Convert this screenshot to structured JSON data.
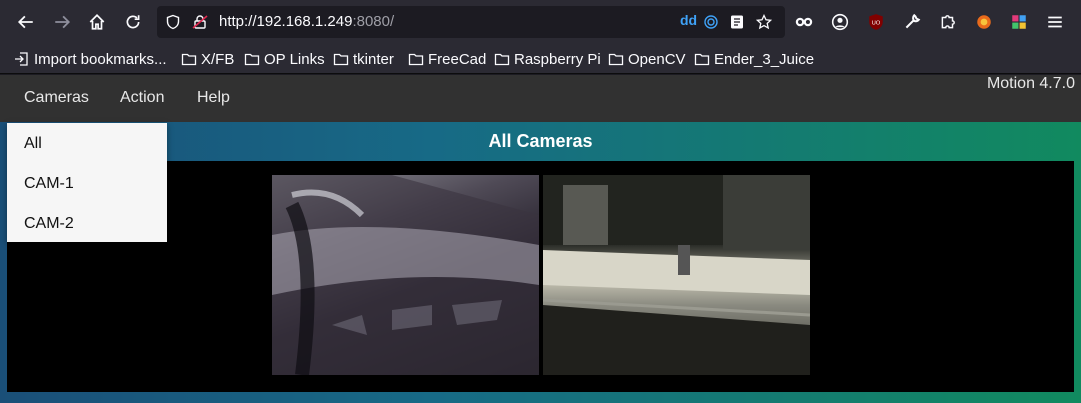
{
  "browser": {
    "url_host": "http://192.168.1.249",
    "url_port": ":8080/",
    "ext_dd": "dd"
  },
  "bookmarks": [
    {
      "label": "Import bookmarks...",
      "icon": "import-icon"
    },
    {
      "label": "X/FB",
      "icon": "folder-icon"
    },
    {
      "label": "OP Links",
      "icon": "folder-icon"
    },
    {
      "label": "tkinter",
      "icon": "folder-icon"
    },
    {
      "label": "FreeCad",
      "icon": "folder-icon"
    },
    {
      "label": "Raspberry Pi",
      "icon": "folder-icon"
    },
    {
      "label": "OpenCV",
      "icon": "folder-icon"
    },
    {
      "label": "Ender_3_Juice",
      "icon": "folder-icon"
    }
  ],
  "nav": {
    "cameras": "Cameras",
    "action": "Action",
    "help": "Help",
    "version": "Motion 4.7.0"
  },
  "dropdown": {
    "items": [
      "All",
      "CAM-1",
      "CAM-2"
    ]
  },
  "main": {
    "title": "All Cameras"
  },
  "colors": {
    "navbar": "#313131",
    "gradient_start": "#1a4f78",
    "gradient_end": "#118a5f",
    "dropdown_bg": "#f6f6f6"
  }
}
